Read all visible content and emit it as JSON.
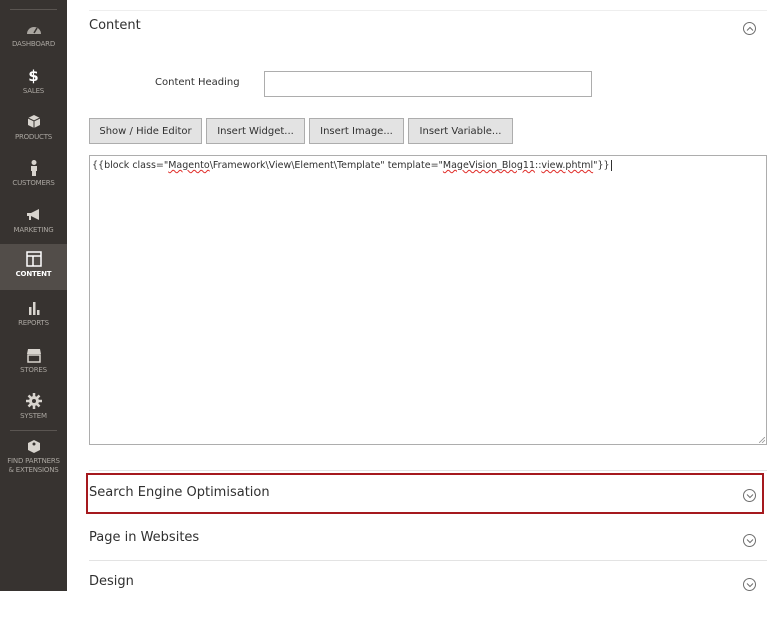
{
  "sidebar": {
    "items": [
      {
        "label": "Dashboard",
        "icon": "dashboard-icon"
      },
      {
        "label": "Sales",
        "icon": "dollar-icon"
      },
      {
        "label": "Products",
        "icon": "box-icon"
      },
      {
        "label": "Customers",
        "icon": "person-icon"
      },
      {
        "label": "Marketing",
        "icon": "megaphone-icon"
      },
      {
        "label": "Content",
        "icon": "layout-icon",
        "active": true
      },
      {
        "label": "Reports",
        "icon": "bar-chart-icon"
      },
      {
        "label": "Stores",
        "icon": "storefront-icon"
      },
      {
        "label": "System",
        "icon": "gear-icon"
      },
      {
        "label": "Find Partners",
        "label2": "& Extensions",
        "icon": "extensions-icon"
      }
    ]
  },
  "content_section": {
    "title": "Content",
    "heading_label": "Content Heading",
    "heading_value": "",
    "buttons": {
      "show_hide": "Show / Hide Editor",
      "insert_widget": "Insert Widget...",
      "insert_image": "Insert Image...",
      "insert_variable": "Insert Variable..."
    },
    "editor": {
      "p1": "{{block class=\"",
      "p2": "Magento",
      "p3": "\\Framework\\View\\Element\\Template\" template=\"",
      "p4": "MageVision_Blog11",
      "p5": "::",
      "p6": "view.phtml",
      "p7": "\"}}"
    }
  },
  "sections": {
    "seo": "Search Engine Optimisation",
    "websites": "Page in Websites",
    "design": "Design"
  },
  "colors": {
    "sidebar_bg": "#373330",
    "sidebar_active": "#524d49",
    "highlight_border": "#a5191e"
  }
}
